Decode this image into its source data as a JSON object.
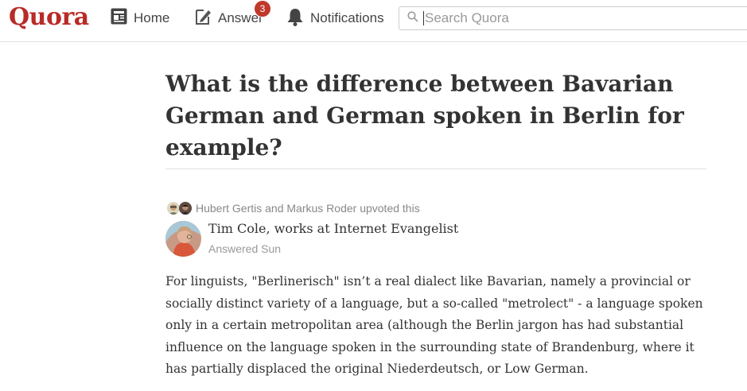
{
  "header": {
    "logo": "Quora",
    "nav": {
      "home_label": "Home",
      "answer_label": "Answer",
      "answer_badge": "3",
      "notifications_label": "Notifications"
    },
    "search": {
      "placeholder": "Search Quora",
      "value": ""
    }
  },
  "question": {
    "title": "What is the difference between Bavarian German and German spoken in Berlin for example?"
  },
  "answer": {
    "upvoters_text": "Hubert Gertis and Markus Roder upvoted this",
    "author_line": "Tim Cole, works at Internet Evangelist",
    "answered": "Answered Sun",
    "body": "For linguists, \"Berlinerisch\" isn’t a real dialect like Bavarian, namely a provincial or socially distinct variety of a language, but a so-called \"metrolect\" - a language spoken only in a certain metropolitan area (although the Berlin jargon has had substantial influence on the language spoken in the surrounding state of Brandenburg, where it has partially displaced the original Niederdeutsch, or Low German."
  },
  "colors": {
    "brand": "#b92b27",
    "badge": "#c0392b",
    "text": "#333333",
    "muted": "#999999"
  },
  "icons": {
    "home": "newspaper-icon",
    "answer": "pencil-icon",
    "notifications": "bell-icon",
    "search": "search-icon"
  }
}
